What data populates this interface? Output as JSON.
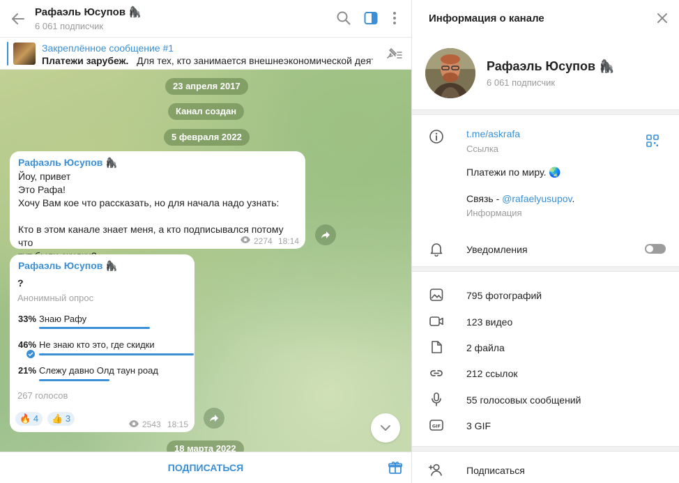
{
  "chat": {
    "title": "Рафаэль Юсупов 🦍",
    "subscribers": "6 061 подписчик",
    "pinned": {
      "title": "Закреплённое сообщение #1",
      "bold": "Платежи зарубеж.",
      "text": "Для тех, кто занимается внешнеэкономической деяте..."
    },
    "dates": [
      "23 апреля 2017",
      "Канал создан",
      "5 февраля 2022",
      "18 марта 2022"
    ],
    "message1": {
      "author": "Рафаэль Юсупов 🦍",
      "lines": [
        "Йоу, привет",
        "Это Рафа!",
        "Хочу Вам кое что рассказать, но для начала надо узнать:",
        "",
        "Кто в этом канале знает меня, а кто подписывался потому что",
        "тут были скидки?"
      ],
      "views": "2274",
      "time": "18:14"
    },
    "poll": {
      "author": "Рафаэль Юсупов 🦍",
      "question": "?",
      "type": "Анонимный опрос",
      "options": [
        {
          "pct": "33%",
          "text": "Знаю Рафу",
          "value": 33
        },
        {
          "pct": "46%",
          "text": "Не знаю кто это, где скидки",
          "value": 46
        },
        {
          "pct": "21%",
          "text": "Слежу давно Олд таун роад",
          "value": 21
        }
      ],
      "votes": "267 голосов",
      "reactions": [
        {
          "emoji": "🔥",
          "count": "4"
        },
        {
          "emoji": "👍",
          "count": "3"
        }
      ],
      "views": "2543",
      "time": "18:15"
    },
    "subscribe_label": "ПОДПИСАТЬСЯ"
  },
  "info": {
    "title": "Информация о канале",
    "name": "Рафаэль Юсупов 🦍",
    "subscribers": "6 061 подписчик",
    "link": "t.me/askrafa",
    "link_label": "Ссылка",
    "desc_line1": "Платежи по миру. 🌏",
    "desc_line2_prefix": "Связь - ",
    "desc_line2_handle": "@rafaelyusupov",
    "desc_line2_suffix": ".",
    "desc_label": "Информация",
    "notifications": "Уведомления",
    "notifications_on": false,
    "media": [
      {
        "icon": "photo-icon",
        "label": "795 фотографий"
      },
      {
        "icon": "video-icon",
        "label": "123 видео"
      },
      {
        "icon": "file-icon",
        "label": "2 файла"
      },
      {
        "icon": "link-icon",
        "label": "212 ссылок"
      },
      {
        "icon": "microphone-icon",
        "label": "55 голосовых сообщений"
      },
      {
        "icon": "gif-icon",
        "label": "3 GIF"
      }
    ],
    "subscribe_action": "Подписаться"
  }
}
